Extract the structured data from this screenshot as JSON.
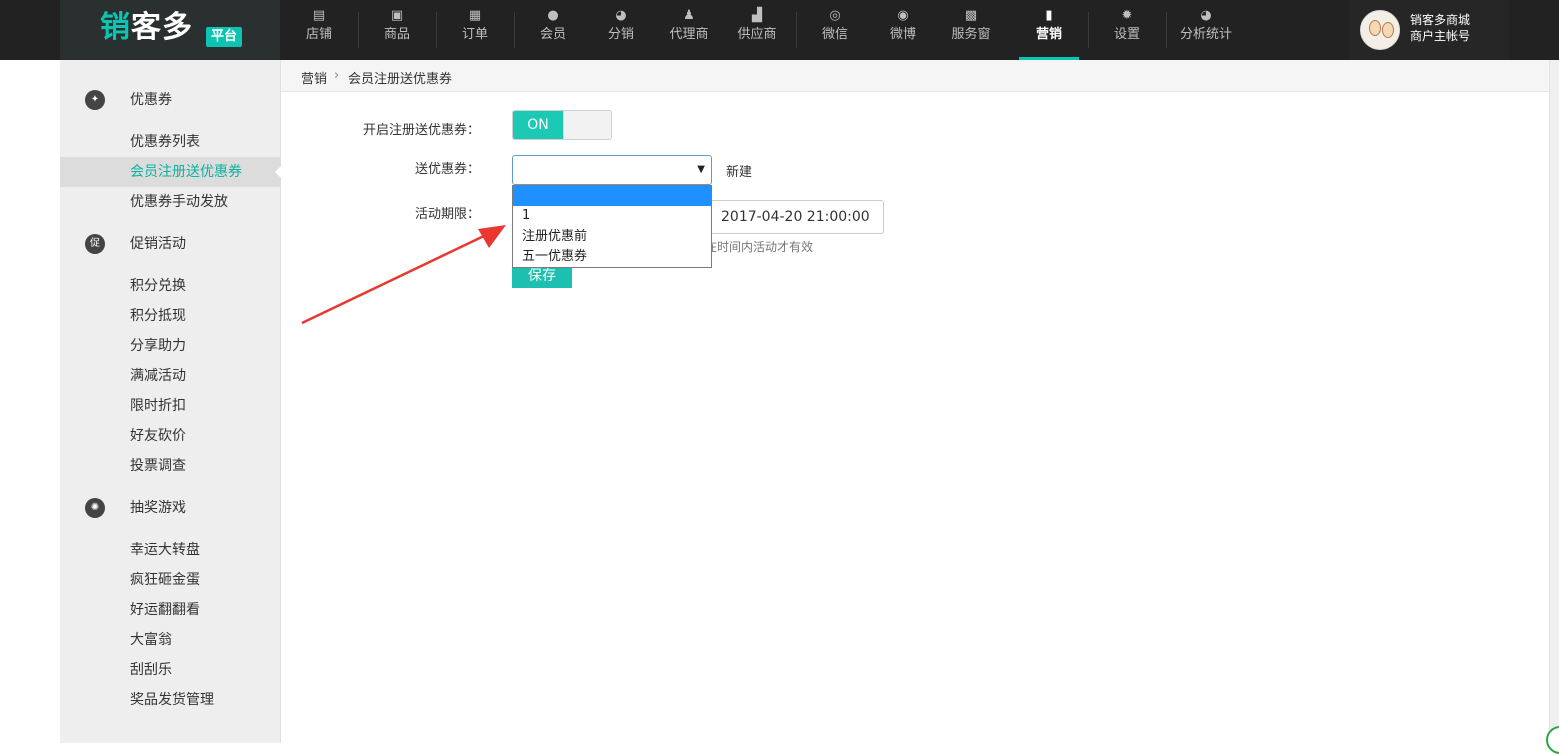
{
  "logo": {
    "text_first": "销",
    "text_rest": "客多",
    "badge": "平台"
  },
  "nav": [
    {
      "label": "店铺",
      "icon": "store-icon",
      "glyph": "▤"
    },
    {
      "label": "商品",
      "icon": "shopping-bag-icon",
      "glyph": "▣"
    },
    {
      "label": "订单",
      "icon": "document-icon",
      "glyph": "▦"
    },
    {
      "label": "会员",
      "icon": "user-icon",
      "glyph": "●"
    },
    {
      "label": "分销",
      "icon": "pie-chart-icon",
      "glyph": "◕"
    },
    {
      "label": "代理商",
      "icon": "agent-icon",
      "glyph": "♟"
    },
    {
      "label": "供应商",
      "icon": "supplier-icon",
      "glyph": "▟"
    },
    {
      "label": "微信",
      "icon": "wechat-icon",
      "glyph": "◎"
    },
    {
      "label": "微博",
      "icon": "weibo-icon",
      "glyph": "◉"
    },
    {
      "label": "服务窗",
      "icon": "alipay-icon",
      "glyph": "▩"
    },
    {
      "label": "营销",
      "icon": "bar-chart-icon",
      "glyph": "▮"
    },
    {
      "label": "设置",
      "icon": "gear-icon",
      "glyph": "✹"
    },
    {
      "label": "分析统计",
      "icon": "analytics-pie-icon",
      "glyph": "◕"
    }
  ],
  "nav_active_index": 10,
  "user": {
    "name": "销客多商城",
    "role": "商户主帐号"
  },
  "sidebar": {
    "groups": [
      {
        "title": "优惠券",
        "icon": "coupon-tag-icon",
        "glyph": "✦"
      },
      {
        "title": "促销活动",
        "icon": "promotion-icon",
        "glyph": "促"
      },
      {
        "title": "抽奖游戏",
        "icon": "lottery-wheel-icon",
        "glyph": "✺"
      }
    ],
    "coupon_items": [
      "优惠券列表",
      "会员注册送优惠券",
      "优惠券手动发放"
    ],
    "promo_items": [
      "积分兑换",
      "积分抵现",
      "分享助力",
      "满减活动",
      "限时折扣",
      "好友砍价",
      "投票调查"
    ],
    "game_items": [
      "幸运大转盘",
      "疯狂砸金蛋",
      "好运翻翻看",
      "大富翁",
      "刮刮乐",
      "奖品发货管理"
    ]
  },
  "breadcrumb": {
    "parent": "营销",
    "separator": "›",
    "current": "会员注册送优惠券"
  },
  "form": {
    "enable_label": "开启注册送优惠券：",
    "toggle_state": "ON",
    "coupon_label": "送优惠券：",
    "coupon_value": "",
    "new_link": "新建",
    "period_label": "活动期限：",
    "end_date": "2017-04-20 21:00:00",
    "hint_partial": "在时间内活动才有效",
    "save_label": "保存"
  },
  "dropdown_options": [
    "",
    "1",
    "注册优惠前",
    "五一优惠券"
  ],
  "dropdown_selected_index": 0,
  "colors": {
    "accent": "#1cc9b4",
    "topbar": "#222222",
    "highlight": "#1e90ff",
    "annotation_arrow": "#e8382f"
  }
}
